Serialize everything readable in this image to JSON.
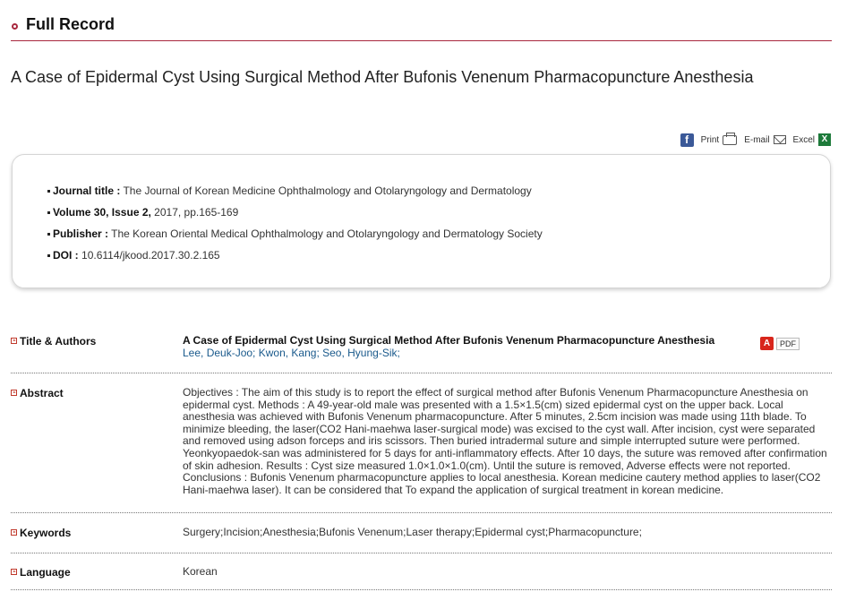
{
  "header": {
    "title": "Full Record"
  },
  "record_title": "A Case of Epidermal Cyst Using Surgical Method After Bufonis Venenum Pharmacopuncture Anesthesia",
  "toolbar": {
    "facebook": "f",
    "print": "Print",
    "email": "E-mail",
    "excel": "Excel",
    "excel_icon": "X"
  },
  "info": {
    "journal_label": "Journal title :",
    "journal_value": "The Journal of Korean Medicine Ophthalmology and Otolaryngology and Dermatology",
    "volume_label": "Volume 30, Issue 2,",
    "volume_value": "2017, pp.165-169",
    "publisher_label": "Publisher :",
    "publisher_value": "The Korean Oriental Medical Ophthalmology and Otolaryngology and Dermatology Society",
    "doi_label": "DOI :",
    "doi_value": "10.6114/jkood.2017.30.2.165"
  },
  "sections": {
    "title_authors": {
      "label": "Title & Authors",
      "paper_title": "A Case of Epidermal Cyst Using Surgical Method After Bufonis Venenum Pharmacopuncture Anesthesia",
      "authors": [
        "Lee, Deuk-Joo;",
        "Kwon, Kang;",
        "Seo, Hyung-Sik;"
      ],
      "pdf_label": "PDF"
    },
    "abstract": {
      "label": "Abstract",
      "text": "Objectives : The aim of this study is to report the effect of surgical method after Bufonis Venenum Pharmacopuncture Anesthesia on epidermal cyst. Methods : A 49-year-old male was presented with a 1.5×1.5(cm) sized epidermal cyst on the upper back. Local anesthesia was achieved with Bufonis Venenum pharmacopuncture. After 5 minutes, 2.5cm incision was made using 11th blade. To minimize bleeding, the laser(CO2 Hani-maehwa laser-surgical mode) was excised to the cyst wall. After incision, cyst were separated and removed using adson forceps and iris scissors. Then buried intradermal suture and simple interrupted suture were performed. Yeonkyopaedok-san was administered for 5 days for anti-inflammatory effects. After 10 days, the suture was removed after confirmation of skin adhesion. Results : Cyst size measured 1.0×1.0×1.0(cm). Until the suture is removed, Adverse effects were not reported. Conclusions : Bufonis Venenum pharmacopuncture applies to local anesthesia. Korean medicine cautery method applies to laser(CO2 Hani-maehwa laser). It can be considered that To expand the application of surgical treatment in korean medicine."
    },
    "keywords": {
      "label": "Keywords",
      "text": "Surgery;Incision;Anesthesia;Bufonis Venenum;Laser therapy;Epidermal cyst;Pharmacopuncture;"
    },
    "language": {
      "label": "Language",
      "text": "Korean"
    }
  },
  "colors": {
    "accent": "#a8283e",
    "link": "#1a5a8c"
  }
}
